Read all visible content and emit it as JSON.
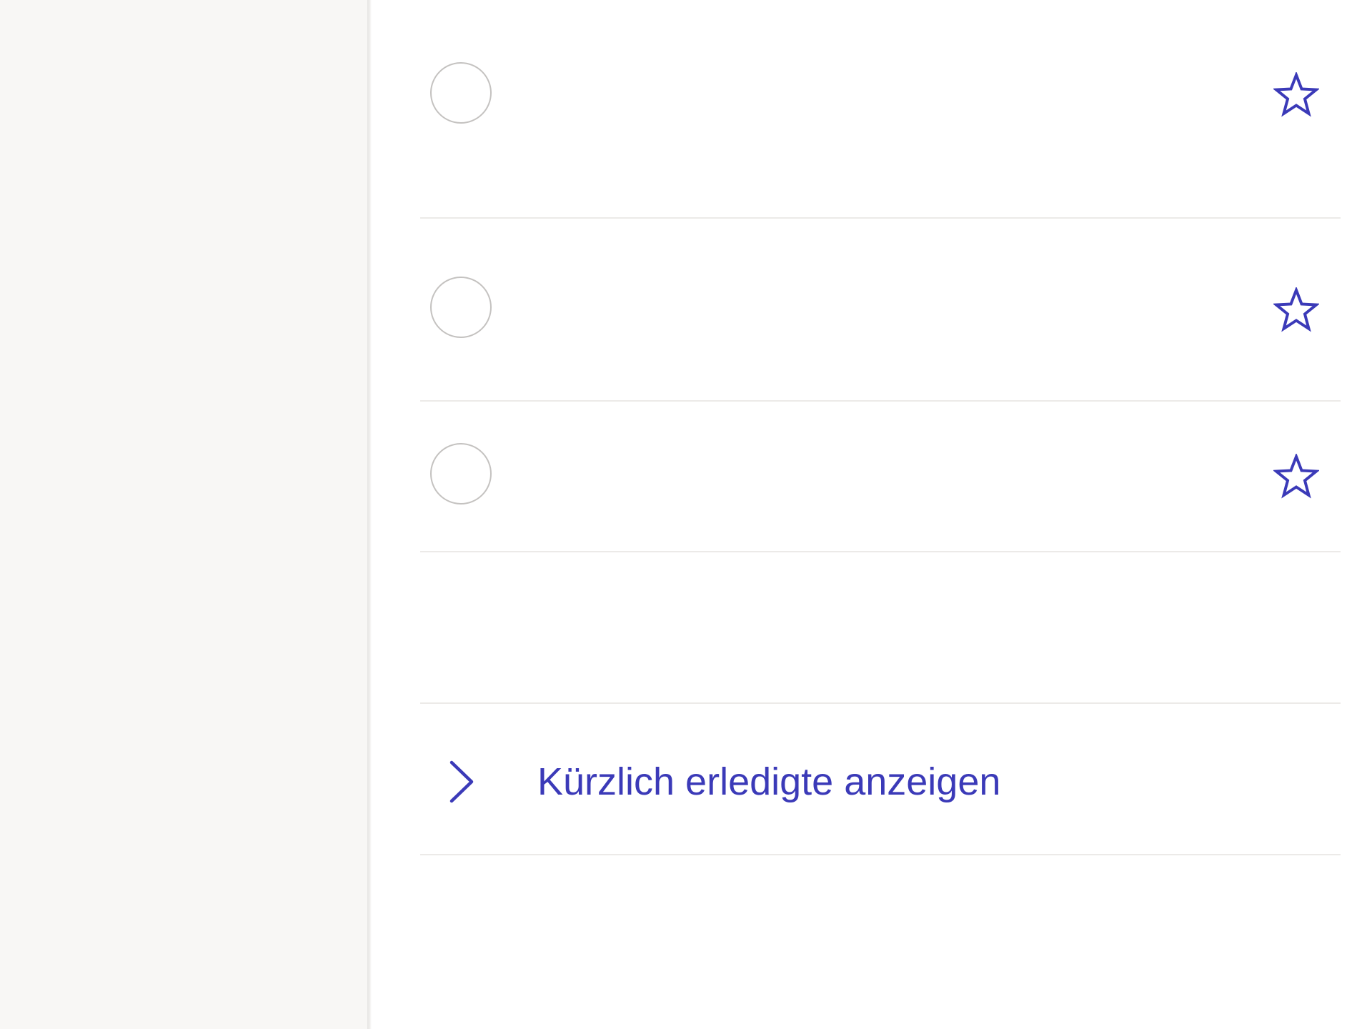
{
  "colors": {
    "accent": "#3b3ab8",
    "sidebar_bg": "#f8f7f5",
    "divider": "#eceae8",
    "checkbox_border": "#c4c2c0"
  },
  "tasks": [
    {
      "title": "",
      "completed": false,
      "important": false,
      "checkbox_icon": "circle-checkbox-icon",
      "star_icon": "star-outline-icon"
    },
    {
      "title": "",
      "completed": false,
      "important": false,
      "checkbox_icon": "circle-checkbox-icon",
      "star_icon": "star-outline-icon"
    },
    {
      "title": "",
      "completed": false,
      "important": false,
      "checkbox_icon": "circle-checkbox-icon",
      "star_icon": "star-outline-icon"
    }
  ],
  "completed_section": {
    "label": "Kürzlich erledigte anzeigen",
    "icon": "chevron-right-icon",
    "expanded": false
  }
}
